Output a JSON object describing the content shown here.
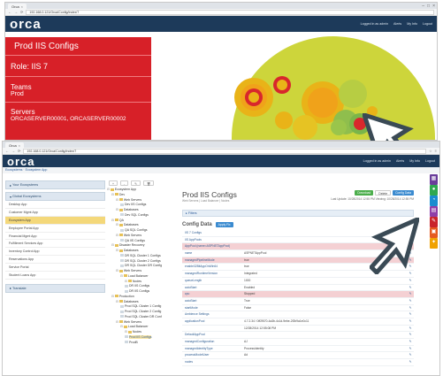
{
  "back_window": {
    "tab_title": "Orca",
    "url": "192.168.0.121/Orca/Config/Index/7",
    "logo": "orca",
    "user_links": [
      "Logged in as admin",
      "Alerts",
      "My Info",
      "Logout"
    ],
    "card": {
      "title": "Prod IIS Configs",
      "role": "Role: IIS 7",
      "teams_label": "Teams",
      "teams_value": "Prod",
      "servers_label": "Servers",
      "servers_value": "ORCASERVER00001, ORCASERVER00002"
    }
  },
  "front_window": {
    "tab_title": "Orca",
    "url": "192.168.0.121/Orca/Config/Index/7",
    "logo": "orca",
    "breadcrumb": "Ecosystems · Ecosystem App",
    "user_links": [
      "Logged in as admin",
      "Alerts",
      "My Info",
      "Logout"
    ],
    "left_panel": {
      "header1": "Your Ecosystems",
      "header2": "Global Ecosystems",
      "items": [
        "Desktop App",
        "Customer Mgmt App",
        "Ecosystem App",
        "Employee Portal App",
        "Financial Mgmt App",
        "Fulfillment Services App",
        "Inventory Control App",
        "Reservations App",
        "Service Portal",
        "Student Loans App"
      ],
      "active_index": 2,
      "footer": "Translate"
    },
    "toolbar_icons": [
      "+",
      "-",
      "✎",
      "🗑"
    ],
    "tree": [
      {
        "t": "Ecosystem App",
        "d": 0,
        "f": true
      },
      {
        "t": "Dev",
        "d": 1,
        "f": true
      },
      {
        "t": "Web Servers",
        "d": 2,
        "f": true
      },
      {
        "t": "Dev IIS Configs",
        "d": 3,
        "f": false
      },
      {
        "t": "Databases",
        "d": 2,
        "f": true
      },
      {
        "t": "Dev SQL Configs",
        "d": 3,
        "f": false
      },
      {
        "t": "QA",
        "d": 1,
        "f": true
      },
      {
        "t": "Databases",
        "d": 2,
        "f": true
      },
      {
        "t": "QA SQL Configs",
        "d": 3,
        "f": false
      },
      {
        "t": "Web Servers",
        "d": 2,
        "f": true
      },
      {
        "t": "QA IIS Configs",
        "d": 3,
        "f": false
      },
      {
        "t": "Disaster Recovery",
        "d": 1,
        "f": true
      },
      {
        "t": "Databases",
        "d": 2,
        "f": true
      },
      {
        "t": "DR SQL Cluster 1 Configs",
        "d": 3,
        "f": false
      },
      {
        "t": "DR SQL Cluster 2 Configs",
        "d": 3,
        "f": false
      },
      {
        "t": "DR SQL Cluster DR Config",
        "d": 3,
        "f": false
      },
      {
        "t": "Web Servers",
        "d": 2,
        "f": true
      },
      {
        "t": "Load Balancer",
        "d": 3,
        "f": true
      },
      {
        "t": "Nodes",
        "d": 4,
        "f": true
      },
      {
        "t": "DR IIS Configs",
        "d": 4,
        "f": false
      },
      {
        "t": "DR IIS Configs",
        "d": 4,
        "f": false
      },
      {
        "t": "Production",
        "d": 1,
        "f": true
      },
      {
        "t": "Databases",
        "d": 2,
        "f": true
      },
      {
        "t": "Prod SQL Cluster 1 Config",
        "d": 3,
        "f": false
      },
      {
        "t": "Prod SQL Cluster 2 Config",
        "d": 3,
        "f": false
      },
      {
        "t": "Prod SQL Cluster DR Conf",
        "d": 3,
        "f": false
      },
      {
        "t": "Web Servers",
        "d": 2,
        "f": true
      },
      {
        "t": "Load Balancer",
        "d": 3,
        "f": true
      },
      {
        "t": "Nodes",
        "d": 4,
        "f": true
      },
      {
        "t": "Prod IIS Configs",
        "d": 4,
        "f": false,
        "sel": true
      },
      {
        "t": "ProdB",
        "d": 4,
        "f": false
      }
    ],
    "content": {
      "title": "Prod IIS Configs",
      "subtitle": "Web Servers | Load Balancer | Nodes",
      "buttons": [
        "Download",
        "Delete",
        "Config Data"
      ],
      "last_update": "Last Update: 10/28/2014 12:55 PM",
      "viewing": "Viewing: 10/28/2014 12:55 PM",
      "filters_label": "Filters",
      "config_title": "Config Data",
      "config_button": "Apply Fix",
      "rows": [
        {
          "k": "IIS 7 Configs",
          "v": "",
          "hl": false
        },
        {
          "k": "IIS AppPools",
          "v": "",
          "hl": false
        },
        {
          "k": "AppPool (name=ASPNETAppPool)",
          "v": "",
          "hl": true
        },
        {
          "k": "name",
          "v": "ASPNETAppPool",
          "hl": false
        },
        {
          "k": "managedPipelineMode",
          "v": "true",
          "hl": true
        },
        {
          "k": "enable32BitAppOnWin64",
          "v": "true",
          "hl": false
        },
        {
          "k": "managedRuntimeVersion",
          "v": "Integrated",
          "hl": false
        },
        {
          "k": "queueLength",
          "v": "1000",
          "hl": false
        },
        {
          "k": "autoStart",
          "v": "Enabled",
          "hl": false
        },
        {
          "k": "cpu",
          "v": "Stopped",
          "hl": true
        },
        {
          "k": "autoStart",
          "v": "True",
          "hl": false
        },
        {
          "k": "startMode",
          "v": "False",
          "hl": false
        },
        {
          "k": "Ambience Settings",
          "v": "",
          "hl": false
        },
        {
          "k": "applicationPool",
          "v": "4.7.2.34 / 0ff2f570-4a3b-4c1d-9ebe-2f2b9a1e0c11",
          "hl": false
        },
        {
          "k": "",
          "v": "12/28/2014 12:55:08 PM",
          "hl": false
        },
        {
          "k": "DefaultAppPool",
          "v": "",
          "hl": false
        },
        {
          "k": "managedConfiguration",
          "v": "AJ",
          "hl": false
        },
        {
          "k": "managedIdentityType",
          "v": "ProcessIdentity",
          "hl": false
        },
        {
          "k": "processModelUser",
          "v": "Ad",
          "hl": false
        },
        {
          "k": "nodes",
          "v": "",
          "hl": false
        }
      ]
    },
    "side_icon_colors": [
      "#6a3d9a",
      "#2fa84f",
      "#1a8ccf",
      "#8e3ea8",
      "#c9242b",
      "#e55a1f",
      "#f0a202"
    ]
  },
  "colors": {
    "red_card": "#d72028",
    "nav": "#1d3a5a",
    "arrow": "#3a4a55"
  }
}
